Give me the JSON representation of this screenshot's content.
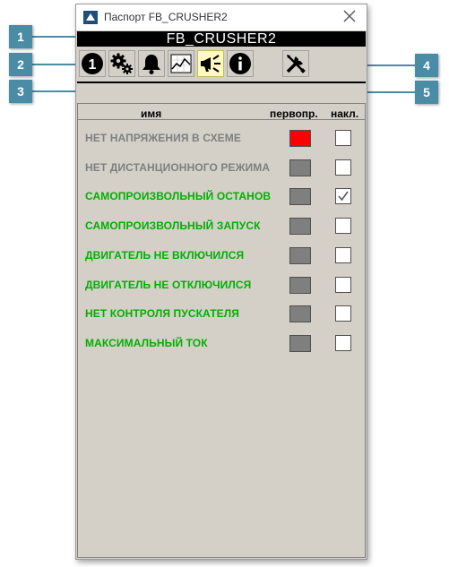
{
  "window": {
    "title": "Паспорт FB_CRUSHER2"
  },
  "header": {
    "name": "FB_CRUSHER2"
  },
  "toolbar": {
    "buttons": [
      {
        "icon": "number-one-icon",
        "active": false
      },
      {
        "icon": "gears-icon",
        "active": false
      },
      {
        "icon": "bell-icon",
        "active": false
      },
      {
        "icon": "trend-chart-icon",
        "active": false
      },
      {
        "icon": "megaphone-icon",
        "active": true
      },
      {
        "icon": "info-icon",
        "active": false
      },
      {
        "icon": "wrench-screwdriver-icon",
        "active": false
      }
    ]
  },
  "columns": {
    "name": "имя",
    "first": "первопр.",
    "accum": "накл."
  },
  "rows": [
    {
      "label": "НЕТ НАПРЯЖЕНИЯ В СХЕМЕ",
      "text_color": "#7f7f7f",
      "indicator_color": "#ff0000",
      "checked": false
    },
    {
      "label": "НЕТ ДИСТАНЦИОННОГО РЕЖИМА",
      "text_color": "#7f7f7f",
      "indicator_color": "#7f7f7f",
      "checked": false
    },
    {
      "label": "САМОПРОИЗВОЛЬНЫЙ ОСТАНОВ",
      "text_color": "#00b000",
      "indicator_color": "#7f7f7f",
      "checked": true
    },
    {
      "label": "САМОПРОИЗВОЛЬНЫЙ ЗАПУСК",
      "text_color": "#00b000",
      "indicator_color": "#7f7f7f",
      "checked": false
    },
    {
      "label": "ДВИГАТЕЛЬ НЕ ВКЛЮЧИЛСЯ",
      "text_color": "#00b000",
      "indicator_color": "#7f7f7f",
      "checked": false
    },
    {
      "label": "ДВИГАТЕЛЬ НЕ ОТКЛЮЧИЛСЯ",
      "text_color": "#00b000",
      "indicator_color": "#7f7f7f",
      "checked": false
    },
    {
      "label": "НЕТ КОНТРОЛЯ ПУСКАТЕЛЯ",
      "text_color": "#00b000",
      "indicator_color": "#7f7f7f",
      "checked": false
    },
    {
      "label": "МАКСИМАЛЬНЫЙ ТОК",
      "text_color": "#00b000",
      "indicator_color": "#7f7f7f",
      "checked": false
    }
  ],
  "callouts": [
    "1",
    "2",
    "3",
    "4",
    "5"
  ],
  "colors": {
    "callout": "#4a8ba6",
    "panel": "#d4d0c8",
    "active_button": "#fff8c0"
  }
}
